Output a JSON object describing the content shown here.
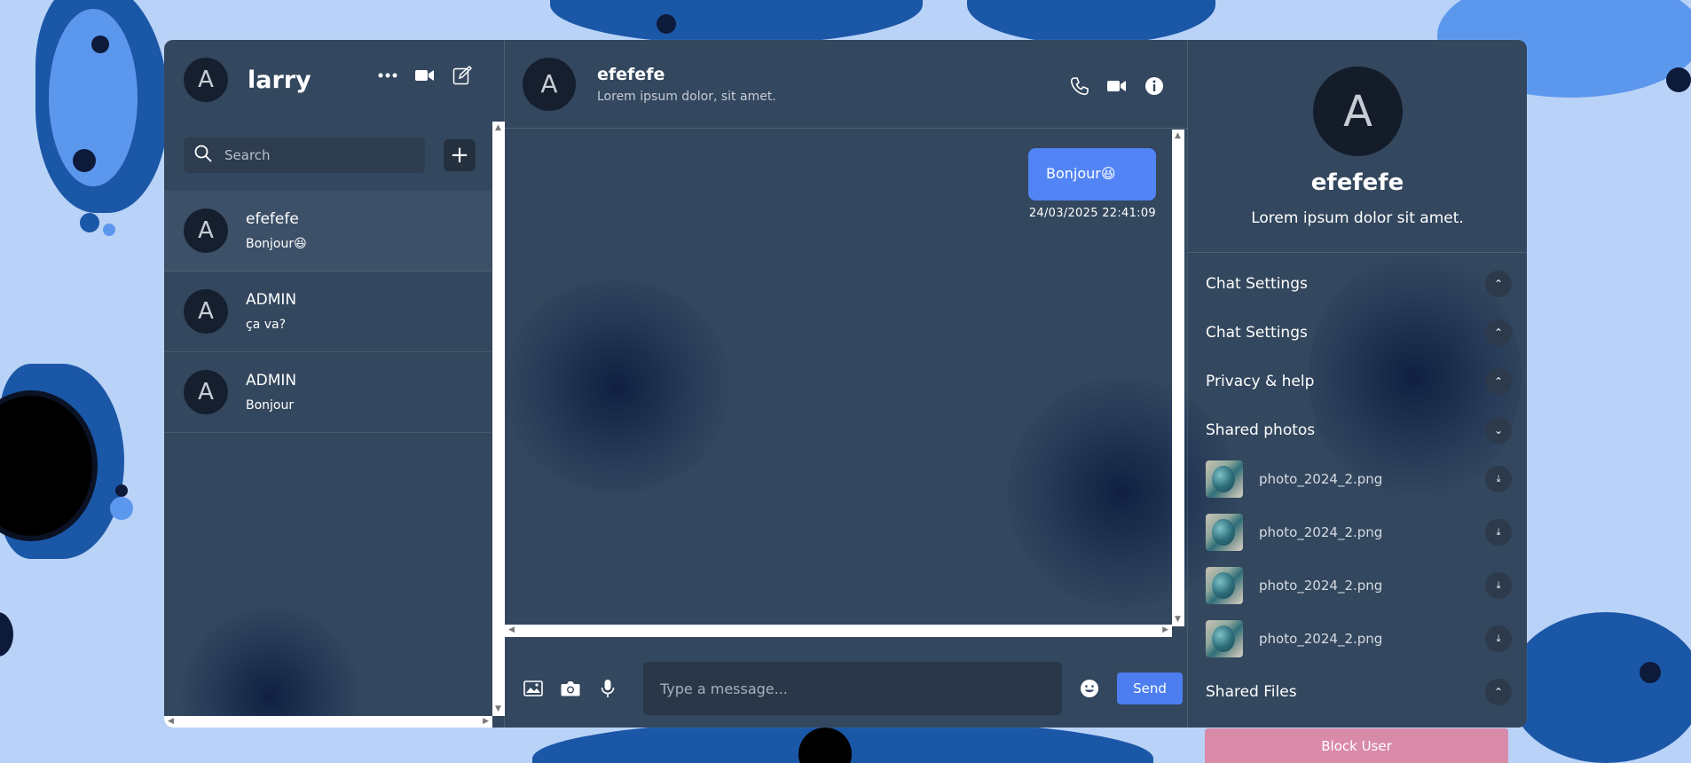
{
  "sidebar": {
    "user": {
      "avatar_letter": "A",
      "name": "larry"
    },
    "icons": [
      "more-icon",
      "video-icon",
      "compose-icon"
    ],
    "search": {
      "placeholder": "Search",
      "value": ""
    },
    "add_label": "+",
    "chats": [
      {
        "avatar_letter": "A",
        "name": "efefefe",
        "last_message": "Bonjour😆",
        "active": true
      },
      {
        "avatar_letter": "A",
        "name": "ADMIN",
        "last_message": "ça va?",
        "active": false
      },
      {
        "avatar_letter": "A",
        "name": "ADMIN",
        "last_message": "Bonjour",
        "active": false
      }
    ]
  },
  "chat": {
    "header": {
      "avatar_letter": "A",
      "name": "efefefe",
      "status": "Lorem ipsum dolor, sit amet."
    },
    "header_icons": [
      "phone-icon",
      "video-icon",
      "info-icon"
    ],
    "messages": [
      {
        "text": "Bonjour😆",
        "time": "24/03/2025 22:41:09",
        "own": true
      }
    ],
    "composer": {
      "icons": [
        "image-icon",
        "camera-icon",
        "mic-icon"
      ],
      "placeholder": "Type a message...",
      "value": "",
      "send_label": "Send"
    }
  },
  "details": {
    "avatar_letter": "A",
    "name": "efefefe",
    "status": "Lorem ipsum dolor sit amet.",
    "sections": [
      {
        "title": "Chat Settings",
        "expanded": false
      },
      {
        "title": "Chat Settings",
        "expanded": false
      },
      {
        "title": "Privacy & help",
        "expanded": false
      },
      {
        "title": "Shared photos",
        "expanded": true
      }
    ],
    "photos": [
      "photo_2024_2.png",
      "photo_2024_2.png",
      "photo_2024_2.png",
      "photo_2024_2.png"
    ],
    "shared_files_title": "Shared Files",
    "block_label": "Block User"
  },
  "colors": {
    "page_bg": "#b9d2f7",
    "panel_bg": "#33475e",
    "accent": "#5284f5",
    "block": "#d98aa8"
  }
}
